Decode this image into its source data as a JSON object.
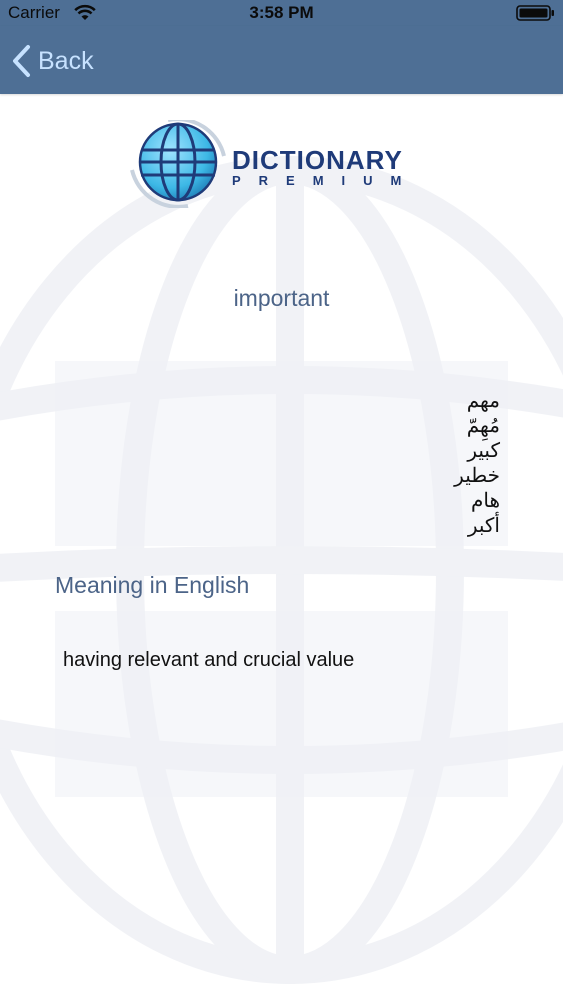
{
  "status_bar": {
    "carrier": "Carrier",
    "time": "3:58 PM"
  },
  "nav": {
    "back_label": "Back"
  },
  "logo": {
    "title": "DICTIONARY",
    "subtitle": "PREMIUM"
  },
  "word": "important",
  "translations": [
    "مهم",
    "مُهِمّ",
    "كبير",
    "خطير",
    "هام",
    "أكبر"
  ],
  "meaning_section": {
    "heading": "Meaning in English",
    "text": "having relevant and crucial value"
  },
  "colors": {
    "nav_bg": "#4e6f95",
    "back_text": "#c7e2ff",
    "heading_text": "#4c6488",
    "logo_blue": "#1f3b79",
    "globe_cyan": "#3db8e6"
  }
}
